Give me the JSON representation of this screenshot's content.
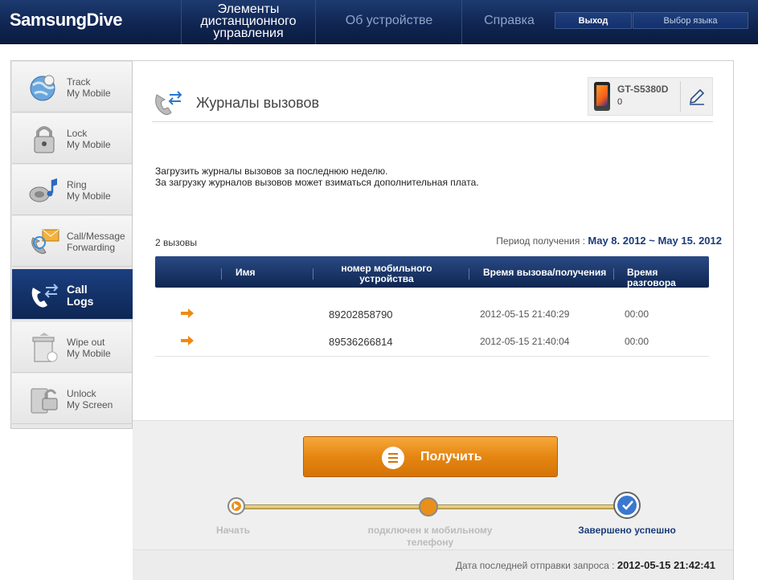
{
  "header": {
    "logo": "SamsungDive",
    "remote_controls": "Элементы\nдистанционного\nуправления",
    "about_device": "Об устройстве",
    "help": "Справка",
    "exit_button": "Выход",
    "language_button": "Выбор языка"
  },
  "sidebar": {
    "items": [
      {
        "label": "Track\nMy Mobile",
        "icon": "globe-icon"
      },
      {
        "label": "Lock\nMy Mobile",
        "icon": "padlock-icon"
      },
      {
        "label": "Ring\nMy Mobile",
        "icon": "speaker-icon"
      },
      {
        "label": "Call/Message\nForwarding",
        "icon": "forwarding-icon"
      },
      {
        "label": "Call\nLogs",
        "icon": "call-logs-icon"
      },
      {
        "label": "Wipe out\nMy Mobile",
        "icon": "trash-icon"
      },
      {
        "label": "Unlock\nMy Screen",
        "icon": "unlock-icon"
      }
    ]
  },
  "page": {
    "title": "Журналы вызовов",
    "device_model": "GT-S5380D",
    "device_count": "0",
    "intro_line1": "Загрузить журналы вызовов за последнюю неделю.",
    "intro_line2": "За загрузку журналов вызовов может взиматься дополнительная плата.",
    "calls_count": "2 вызовы",
    "period_label": "Период получения :",
    "period_value": "May 8. 2012 ~ May 15. 2012"
  },
  "table": {
    "columns": [
      "Имя",
      "номер мобильного\nустройства",
      "Время вызова/получения",
      "Время разговора"
    ],
    "rows": [
      {
        "direction": "outgoing-arrow",
        "name": "",
        "number": "89202858790",
        "time": "2012-05-15 21:40:29",
        "duration": "00:00"
      },
      {
        "direction": "outgoing-arrow",
        "name": "",
        "number": "89536266814",
        "time": "2012-05-15 21:40:04",
        "duration": "00:00"
      }
    ]
  },
  "actions": {
    "get_button": "Получить",
    "steps": [
      "Начать",
      "подключен к мобильному\nтелефону",
      "Завершено успешно"
    ],
    "last_request_label": "Дата последней отправки запроса :",
    "last_request_value": "2012-05-15 21:42:41"
  },
  "colors": {
    "header_bg": "#0f2450",
    "accent_orange": "#e58612",
    "active_nav": "#0d2654",
    "complete_step": "#1a3c7a"
  }
}
